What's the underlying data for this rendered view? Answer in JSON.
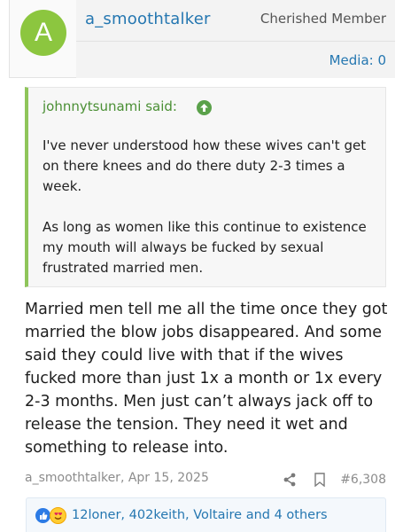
{
  "author": {
    "avatar_letter": "A",
    "avatar_color": "#8cc63f",
    "username": "a_smoothtalker",
    "title": "Cherished Member",
    "media_label": "Media: 0"
  },
  "quote": {
    "header": "johnnytsunami said:",
    "paragraphs": [
      "I've never understood how these wives can't get on there knees and do there duty 2-3 times a week.",
      "As long as women like this continue to existence my mouth will always be fucked by sexual frustrated married men."
    ]
  },
  "message": "Married men tell me all the time once they got married the blow jobs disappeared. And some said they could live with that if the wives fucked more than just 1x a month or 1x every 2-3 months. Men just can’t always jack off to release the tension. They need it wet and something to release into.",
  "meta": {
    "author_date": "a_smoothtalker, Apr 15, 2025",
    "post_number": "#6,308"
  },
  "reactions": {
    "icons": [
      "like-icon",
      "love-icon"
    ],
    "text": "12loner, 402keith, Voltaire and 4 others"
  },
  "colors": {
    "link": "#2577b1",
    "quote_accent": "#8fc55b",
    "quote_header": "#4a8f34"
  }
}
